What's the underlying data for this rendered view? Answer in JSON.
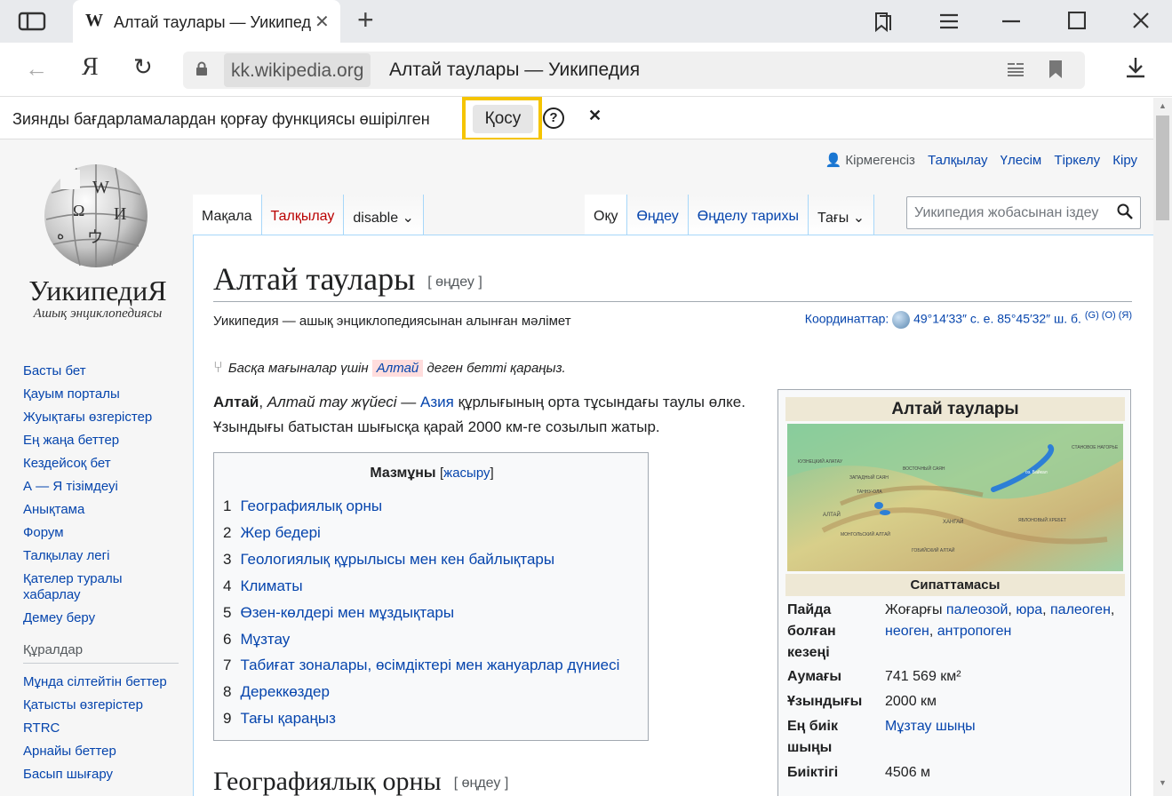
{
  "browser": {
    "tab_favicon": "W",
    "tab_title": "Алтай таулары — Уикипедия",
    "tab_close": "✕",
    "new_tab": "+",
    "domain": "kk.wikipedia.org",
    "page_title": "Алтай таулары — Уикипедия",
    "yandex_logo": "Я"
  },
  "notification": {
    "text": "Зиянды бағдарламалардан қорғау функциясы өшірілген",
    "button": "Қосу",
    "help": "?",
    "close": "✕"
  },
  "wiki": {
    "logo_word": "УикипедиЯ",
    "logo_tagline": "Ашық энциклопедиясы",
    "personal": [
      "Кірмегенсіз",
      "Талқылау",
      "Үлесім",
      "Тіркелу",
      "Кіру"
    ],
    "nav": [
      "Басты бет",
      "Қауым порталы",
      "Жуықтағы өзгерістер",
      "Ең жаңа беттер",
      "Кездейсоқ бет",
      "А — Я тізімдеуі",
      "Анықтама",
      "Форум",
      "Талқылау легі",
      "Қателер туралы хабарлау",
      "Демеу беру"
    ],
    "tools_heading": "Құралдар",
    "tools": [
      "Мұнда сілтейтін беттер",
      "Қатысты өзгерістер",
      "RTRC",
      "Арнайы беттер",
      "Басып шығару"
    ],
    "tabs_left": [
      "Мақала",
      "Талқылау",
      "disable"
    ],
    "tabs_right": [
      "Оқу",
      "Өңдеу",
      "Өңделу тарихы",
      "Тағы"
    ],
    "search_placeholder": "Уикипедия жобасынан іздеу",
    "title": "Алтай таулары",
    "edit_link": "[ өңдеу ]",
    "subtitle": "Уикипедия — ашық энциклопедиясынан алынған мәлімет",
    "coords_label": "Координаттар:",
    "coords_value": "49°14′33″ с. е. 85°45′32″ ш. б.",
    "coords_links": "(G) (O) (Я)",
    "hatnote_pre": "Басқа мағыналар үшін",
    "hatnote_link": "Алтай",
    "hatnote_post": "деген бетті қараңыз.",
    "lead_bold": "Алтай",
    "lead_italic": "Алтай тау жүйесі",
    "lead_dash": " — ",
    "lead_link": "Азия",
    "lead_rest": " құрлығының орта тұсындағы таулы өлке. Ұзындығы батыстан шығысқа қарай 2000 км-ге созылып жатыр.",
    "toc_title": "Мазмұны",
    "toc_toggle": "жасыру",
    "toc": [
      {
        "num": "1",
        "text": "Географиялық орны"
      },
      {
        "num": "2",
        "text": "Жер бедері"
      },
      {
        "num": "3",
        "text": "Геологиялық құрылысы мен кен байлықтары"
      },
      {
        "num": "4",
        "text": "Климаты"
      },
      {
        "num": "5",
        "text": "Өзен-көлдері мен мұздықтары"
      },
      {
        "num": "6",
        "text": "Мұзтау"
      },
      {
        "num": "7",
        "text": "Табиғат зоналары, өсімдіктері мен жануарлар дүниесі"
      },
      {
        "num": "8",
        "text": "Дереккөздер"
      },
      {
        "num": "9",
        "text": "Тағы қараңыз"
      }
    ],
    "h2": "Географиялық орны",
    "infobox": {
      "title": "Алтай таулары",
      "subheader": "Сипаттамасы",
      "map_labels": [
        "КУЗНЕЦКИЙ АЛАТАУ",
        "ЗАПАДНЫЙ САЯН",
        "ВОСТОЧНЫЙ САЯН",
        "ТАННУ-ОЛА",
        "АЛТАЙ",
        "МОНГОЛЬСКИЙ АЛТАЙ",
        "ХАНГАЙ",
        "ГОБИЙСКИЙ АЛТАЙ",
        "ЯБЛОНОВЫЙ ХРЕБЕТ",
        "СТАНОВОЕ НАГОРЬЕ",
        "оз. Байкал"
      ],
      "rows": [
        {
          "label": "Пайда болған кезеңі",
          "value_prefix": "Жоғарғы ",
          "links": [
            "палеозой",
            "юра",
            "палеоген",
            "неоген",
            "антропоген"
          ]
        },
        {
          "label": "Аумағы",
          "value": "741 569 км²"
        },
        {
          "label": "Ұзындығы",
          "value": "2000 км"
        },
        {
          "label": "Ең биік шыңы",
          "value_link": "Мұзтау шыңы"
        },
        {
          "label": "Биіктігі",
          "value": "4506 м"
        }
      ]
    }
  },
  "colors": {
    "link": "#0645ad",
    "highlight": "#f5c400",
    "infobox_header": "#eee8d5"
  }
}
